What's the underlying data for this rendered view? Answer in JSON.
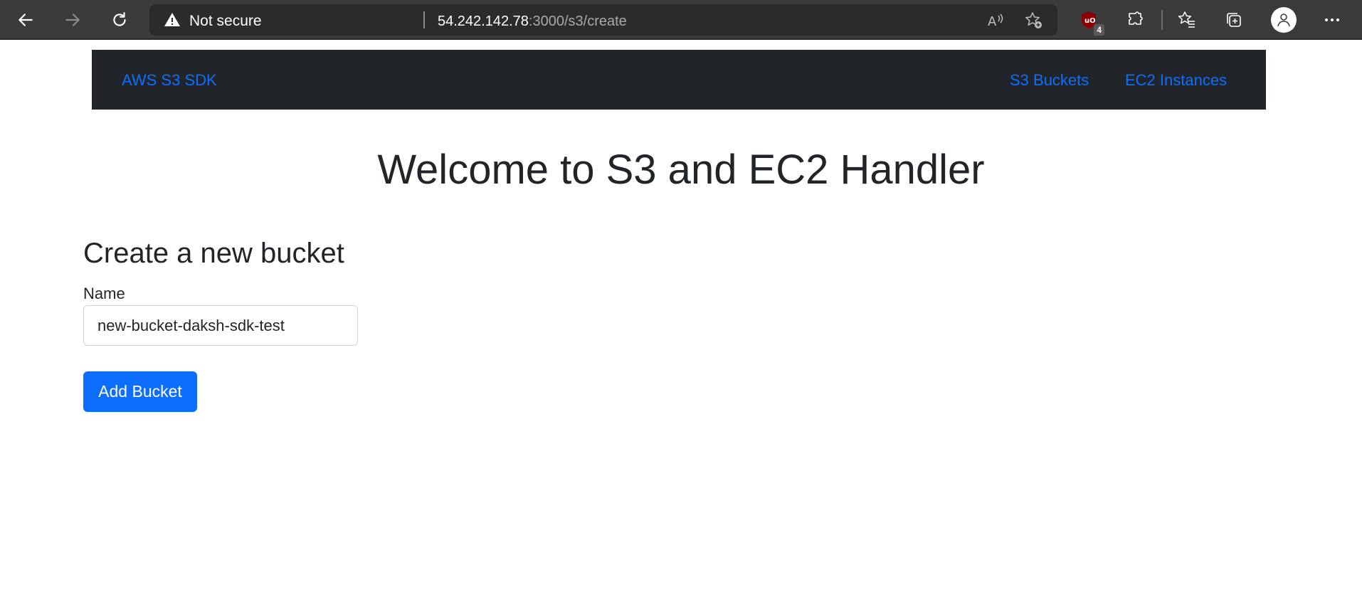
{
  "browser": {
    "security_label": "Not secure",
    "url_host": "54.242.142.78",
    "url_rest": ":3000/s3/create",
    "extension_badge": "4",
    "icons": [
      "back-icon",
      "forward-icon",
      "refresh-icon",
      "warning-icon",
      "read-aloud-icon",
      "add-favorite-icon",
      "ublock-icon",
      "extensions-icon",
      "favorites-icon",
      "collections-icon",
      "profile-icon",
      "more-icon"
    ]
  },
  "navbar": {
    "brand": "AWS S3 SDK",
    "links": [
      "S3 Buckets",
      "EC2 Instances"
    ]
  },
  "page": {
    "heading": "Welcome to S3 and EC2 Handler",
    "form_title": "Create a new bucket",
    "name_label": "Name",
    "name_value": "new-bucket-daksh-sdk-test",
    "submit_label": "Add Bucket"
  },
  "colors": {
    "link": "#0d6efd",
    "navbar_bg": "#212529",
    "button_bg": "#0d6efd",
    "browser_bg": "#3b3b3b"
  }
}
